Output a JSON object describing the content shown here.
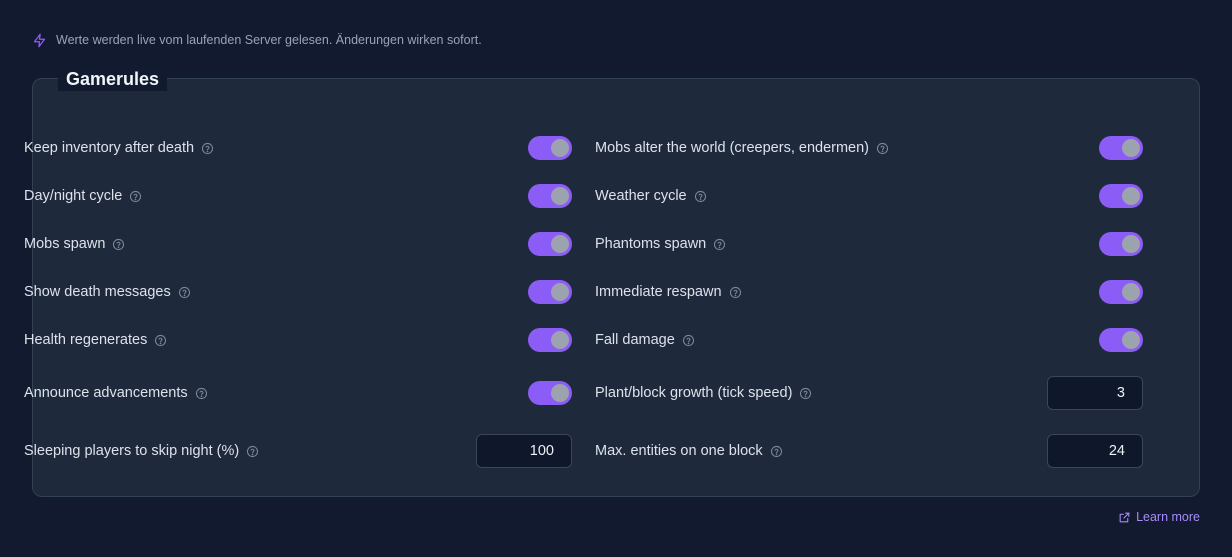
{
  "notice": {
    "icon": "lightning-icon",
    "text": "Werte werden live vom laufenden Server gelesen. Änderungen wirken sofort."
  },
  "card": {
    "title": "Gamerules"
  },
  "left": [
    {
      "label": "Keep inventory after death",
      "type": "toggle",
      "on": true
    },
    {
      "label": "Day/night cycle",
      "type": "toggle",
      "on": true
    },
    {
      "label": "Mobs spawn",
      "type": "toggle",
      "on": true
    },
    {
      "label": "Show death messages",
      "type": "toggle",
      "on": true
    },
    {
      "label": "Health regenerates",
      "type": "toggle",
      "on": true
    },
    {
      "label": "Announce advancements",
      "type": "toggle",
      "on": true
    },
    {
      "label": "Sleeping players to skip night (%)",
      "type": "number",
      "value": "100"
    }
  ],
  "right": [
    {
      "label": "Mobs alter the world (creepers, endermen)",
      "type": "toggle",
      "on": true
    },
    {
      "label": "Weather cycle",
      "type": "toggle",
      "on": true
    },
    {
      "label": "Phantoms spawn",
      "type": "toggle",
      "on": true
    },
    {
      "label": "Immediate respawn",
      "type": "toggle",
      "on": true
    },
    {
      "label": "Fall damage",
      "type": "toggle",
      "on": true
    },
    {
      "label": "Plant/block growth (tick speed)",
      "type": "number",
      "value": "3"
    },
    {
      "label": "Max. entities on one block",
      "type": "number",
      "value": "24"
    }
  ],
  "footer": {
    "learn_more": "Learn more",
    "icon": "external-link-icon"
  },
  "colors": {
    "accent": "#8b5cf6",
    "background": "#111a2e",
    "card": "#1e293b"
  }
}
